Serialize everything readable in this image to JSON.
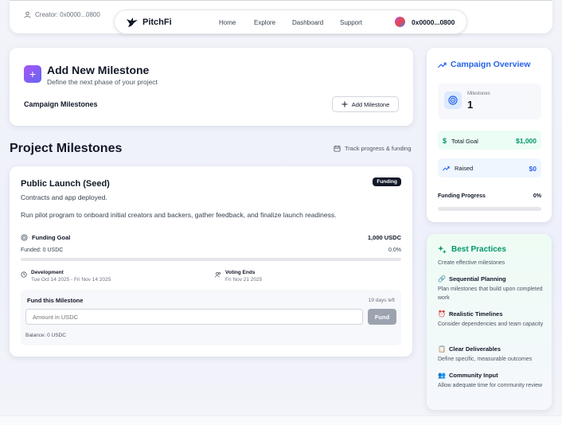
{
  "header": {
    "creator": "Creator: 0x0000...0800",
    "brand": "PitchFi",
    "nav": [
      "Home",
      "Explore",
      "Dashboard",
      "Support"
    ],
    "wallet": "0x0000...0800"
  },
  "add_milestone": {
    "title": "Add New Milestone",
    "subtitle": "Define the next phase of your project",
    "section_label": "Campaign Milestones",
    "button": "Add Milestone",
    "plus_glyph": "+"
  },
  "project_milestones": {
    "title": "Project Milestones",
    "track": "Track progress & funding"
  },
  "milestone": {
    "title": "Public Launch (Seed)",
    "badge": "Funding",
    "summary": "Contracts and app deployed.",
    "description": "Run pilot program to onboard initial creators and backers, gather feedback, and finalize launch readiness.",
    "goal_label": "Funding Goal",
    "goal_value": "1,000 USDC",
    "funded": "Funded: 0 USDC",
    "funded_pct": "0.0%",
    "funded_fraction": 0,
    "dev_label": "Development",
    "dev_dates": "Tue Oct 14 2025 - Fri Nov 14 2025",
    "voting_label": "Voting Ends",
    "voting_date": "Fri Nov 21 2025",
    "fund_title": "Fund this Milestone",
    "days_left": "19 days left",
    "amount_placeholder": "Amount in USDC",
    "fund_button": "Fund",
    "balance": "Balance: 0 USDC"
  },
  "overview": {
    "title": "Campaign Overview",
    "milestones_label": "Milestones",
    "milestones_value": "1",
    "total_goal_label": "Total Goal",
    "total_goal_value": "$1,000",
    "raised_label": "Raised",
    "raised_value": "$0",
    "progress_label": "Funding Progress",
    "progress_value": "0%",
    "progress_fraction": 0
  },
  "best_practices": {
    "title": "Best Practices",
    "subtitle": "Create effective milestones",
    "tips": [
      {
        "title": "Sequential Planning",
        "desc": "Plan milestones that build upon completed work",
        "icon": "link-icon"
      },
      {
        "title": "Realistic Timelines",
        "desc": "Consider dependencies and team capacity",
        "icon": "alarm-icon"
      },
      {
        "title": "Clear Deliverables",
        "desc": "Define specific, measurable outcomes",
        "icon": "clipboard-icon"
      },
      {
        "title": "Community Input",
        "desc": "Allow adequate time for community review",
        "icon": "people-icon"
      }
    ]
  },
  "colors": {
    "accent_blue": "#2563eb",
    "accent_green": "#059669",
    "accent_purple": "#a855f7"
  }
}
